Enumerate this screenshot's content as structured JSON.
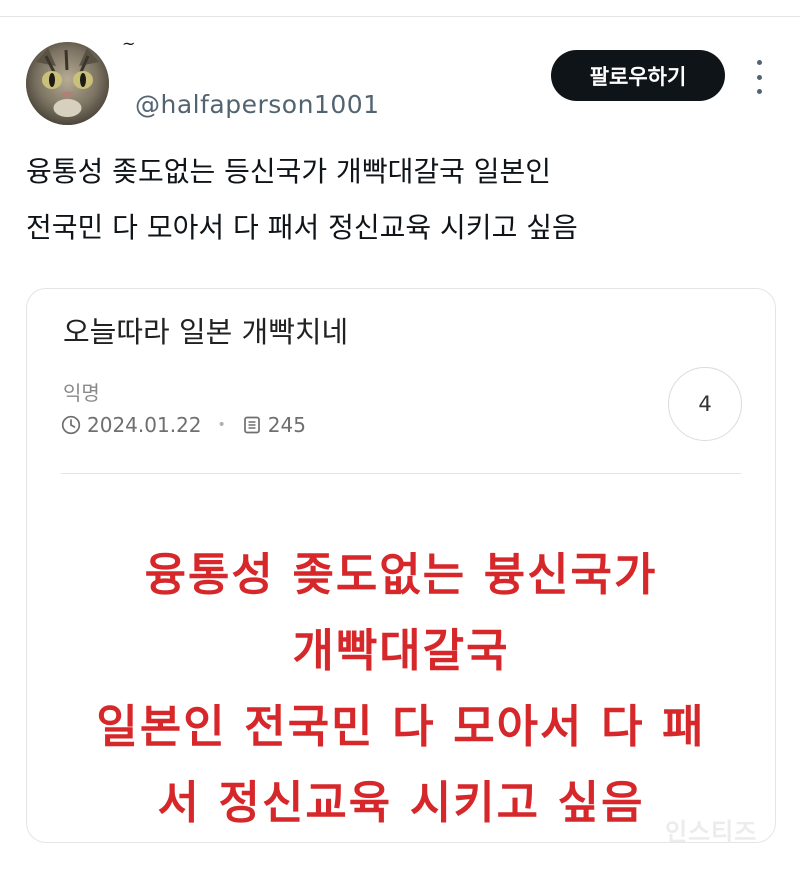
{
  "user": {
    "display_name": "~",
    "handle": "@halfaperson1001"
  },
  "header": {
    "follow_label": "팔로우하기"
  },
  "tweet": {
    "lines": [
      "융통성 좆도없는 등신국가 개빡대갈국 일본인",
      "전국민 다 모아서 다 패서 정신교육 시키고 싶음"
    ]
  },
  "post_card": {
    "title": "오늘따라 일본 개빡치네",
    "author": "익명",
    "date": "2024.01.22",
    "views": "245",
    "comment_count": "4",
    "body_lines": [
      "융통성 좆도없는 븅신국가",
      "개빡대갈국",
      "일본인 전국민 다 모아서 다 패",
      "서 정신교육 시키고 싶음"
    ]
  },
  "watermark": "인스티즈",
  "colors": {
    "follow_bg": "#0f1419",
    "handle": "#536471",
    "red_text": "#d6282a"
  }
}
